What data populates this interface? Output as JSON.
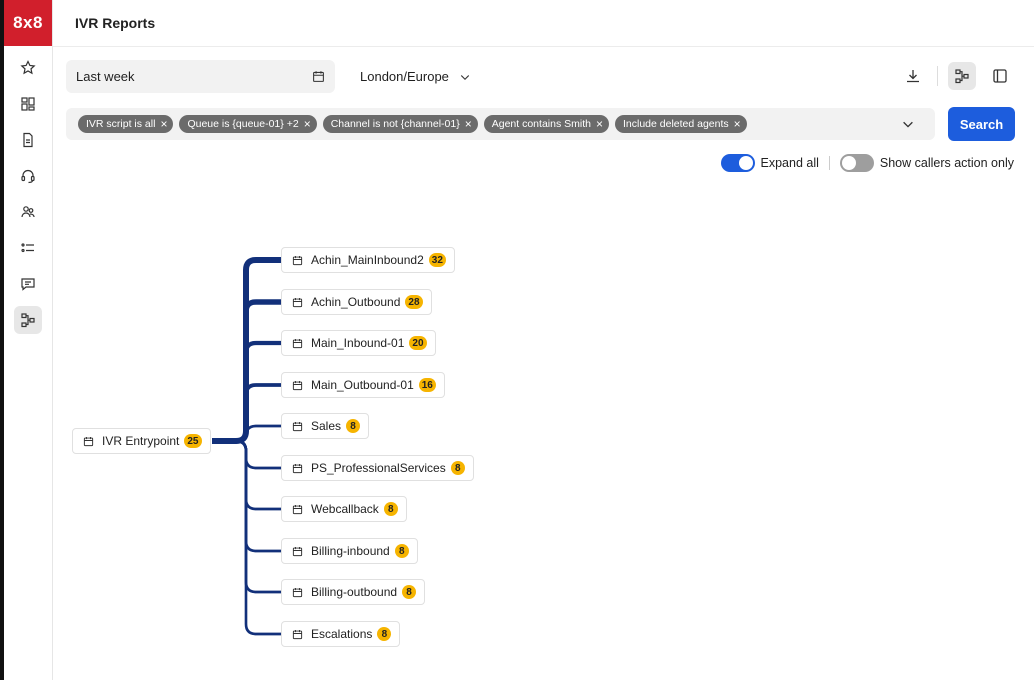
{
  "app": {
    "logo": "8x8",
    "title": "IVR Reports"
  },
  "sidebar": {
    "items": [
      {
        "icon": "star-icon"
      },
      {
        "icon": "dashboard-icon"
      },
      {
        "icon": "document-icon"
      },
      {
        "icon": "headset-icon"
      },
      {
        "icon": "users-icon"
      },
      {
        "icon": "list-icon"
      },
      {
        "icon": "chat-icon"
      },
      {
        "icon": "ivr-flow-icon",
        "active": true
      }
    ]
  },
  "filters": {
    "date_range": "Last week",
    "timezone": "London/Europe",
    "chips": [
      "IVR script is all",
      "Queue is {queue-01} +2",
      "Channel is not {channel-01}",
      "Agent contains Smith",
      "Include deleted agents"
    ],
    "search_label": "Search"
  },
  "toggles": {
    "expand_all": {
      "label": "Expand all",
      "on": true
    },
    "callers_only": {
      "label": "Show callers action only",
      "on": false
    }
  },
  "tree": {
    "root": {
      "label": "IVR Entrypoint",
      "count": "25"
    },
    "children": [
      {
        "label": "Achin_MainInbound2",
        "count": "32"
      },
      {
        "label": "Achin_Outbound",
        "count": "28"
      },
      {
        "label": "Main_Inbound-01",
        "count": "20"
      },
      {
        "label": "Main_Outbound-01",
        "count": "16"
      },
      {
        "label": "Sales",
        "count": "8"
      },
      {
        "label": "PS_ProfessionalServices",
        "count": "8"
      },
      {
        "label": "Webcallback",
        "count": "8"
      },
      {
        "label": "Billing-inbound",
        "count": "8"
      },
      {
        "label": "Billing-outbound",
        "count": "8"
      },
      {
        "label": "Escalations",
        "count": "8"
      }
    ]
  },
  "colors": {
    "brand": "#d11f2c",
    "accent": "#1d5ddd",
    "badge": "#f6b400",
    "tree_line": "#12307a"
  }
}
